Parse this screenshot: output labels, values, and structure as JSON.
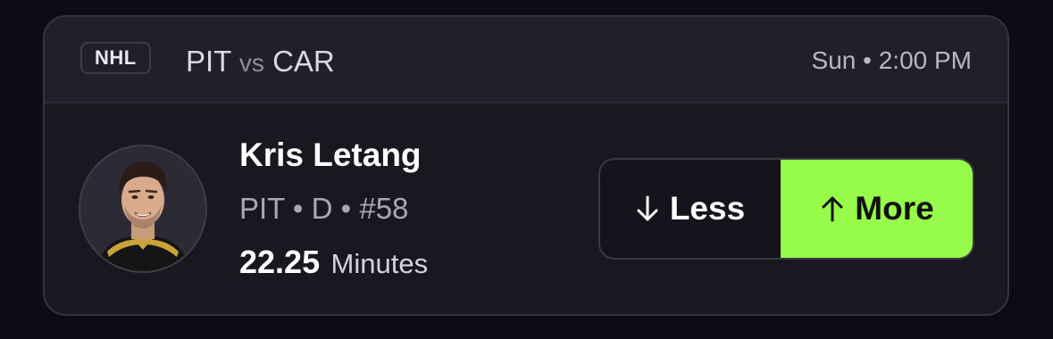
{
  "header": {
    "league": "NHL",
    "team_home": "PIT",
    "vs": "vs",
    "team_away": "CAR",
    "game_time": "Sun • 2:00 PM"
  },
  "player": {
    "name": "Kris Letang",
    "team": "PIT",
    "position": "D",
    "number": "#58",
    "meta_line": "PIT • D • #58",
    "avatar_icon": "player-headshot"
  },
  "projection": {
    "value": "22.25",
    "stat": "Minutes"
  },
  "picks": {
    "less_label": "Less",
    "more_label": "More",
    "less_icon": "arrow-down-icon",
    "more_icon": "arrow-up-icon",
    "selected": "more"
  },
  "colors": {
    "background": "#0d0c15",
    "card": "#191821",
    "header": "#211f2a",
    "accent_selected": "#97fb4a"
  }
}
